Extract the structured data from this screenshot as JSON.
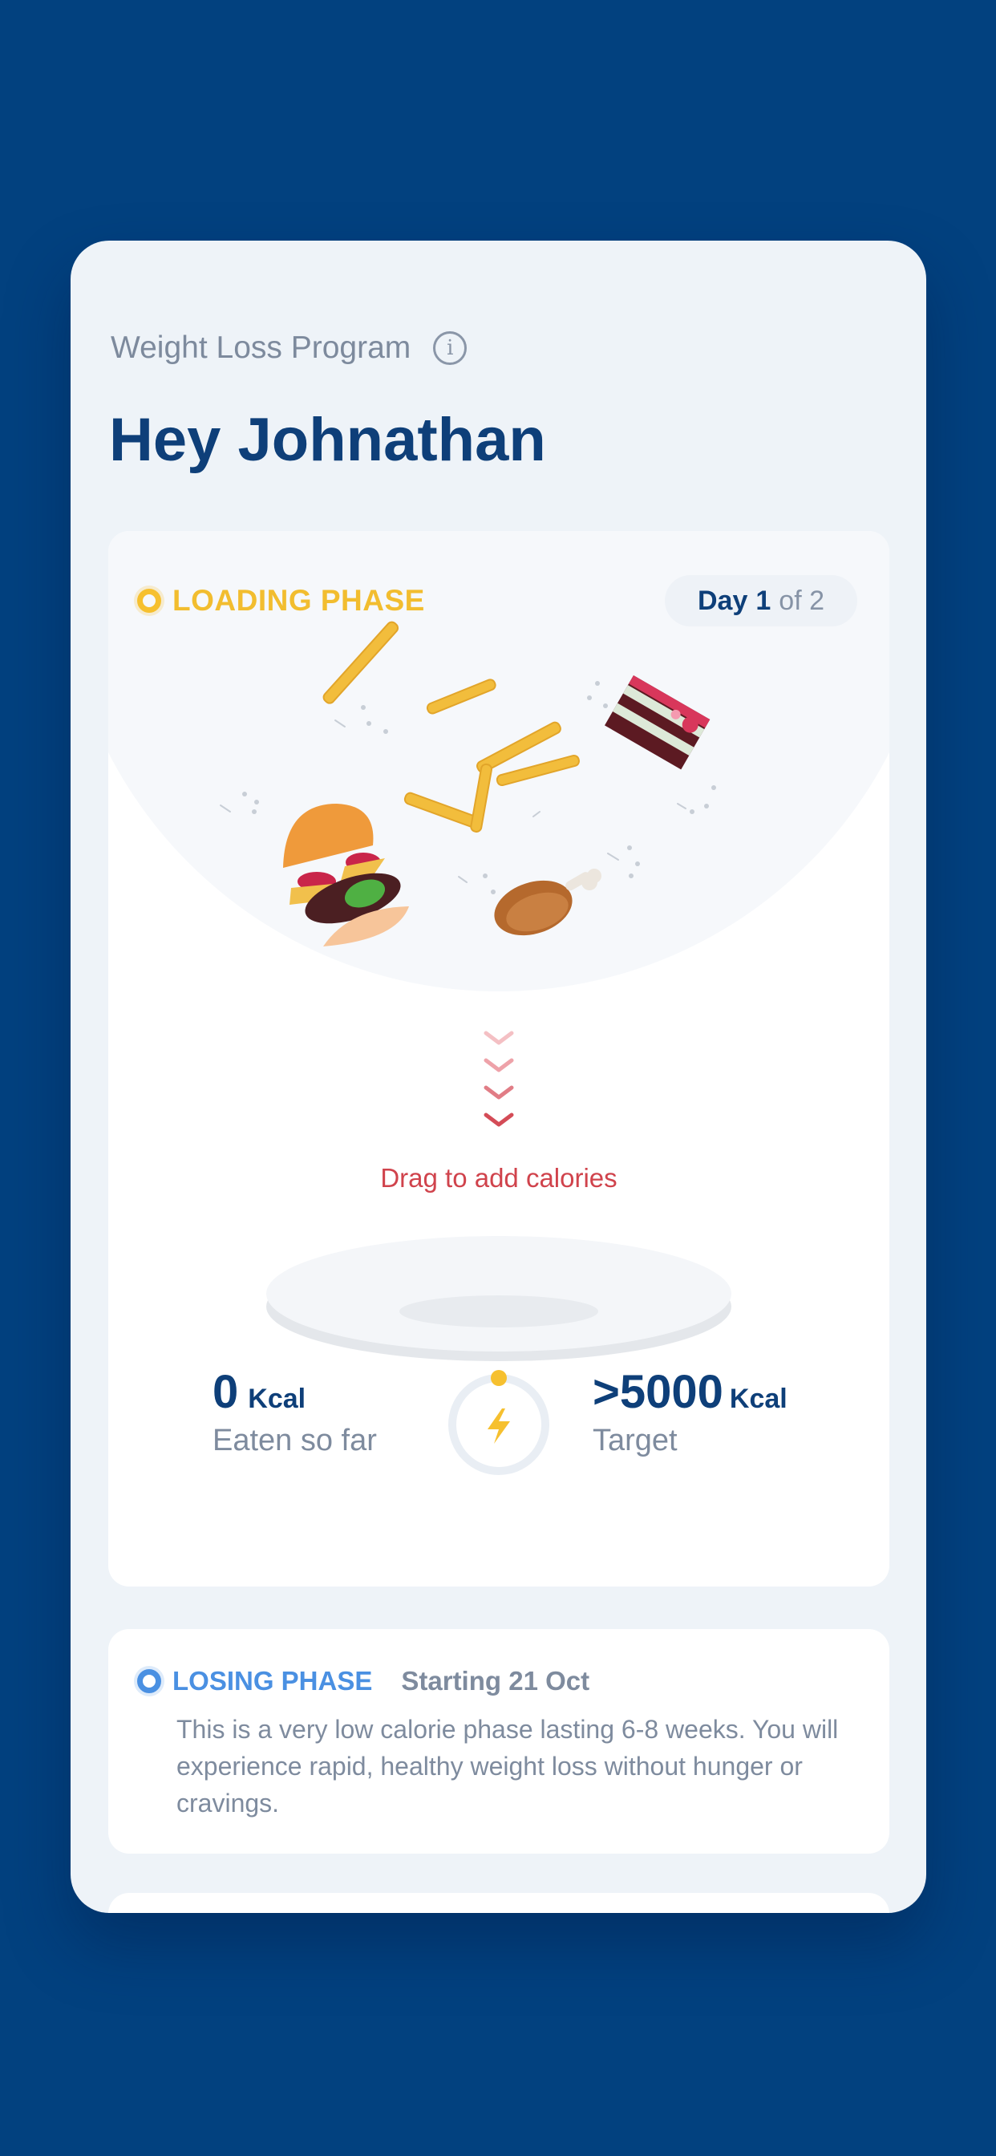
{
  "header": {
    "program_label": "Weight Loss Program",
    "info_icon": "info-icon",
    "greeting": "Hey Johnathan"
  },
  "loading_phase": {
    "title": "LOADING PHASE",
    "day_label": "Day",
    "day_current": "1",
    "day_total_text": "of 2",
    "drag_hint": "Drag to add calories",
    "eaten_value": "0",
    "eaten_unit": "Kcal",
    "eaten_caption": "Eaten so far",
    "target_value": ">5000",
    "target_unit": "Kcal",
    "target_caption": "Target",
    "gauge_icon": "lightning-icon",
    "progress_fraction": 0,
    "colors": {
      "accent": "#f2bd2f",
      "title": "#0e3f79",
      "drag": "#d0434c"
    }
  },
  "losing_phase": {
    "title": "LOSING PHASE",
    "start": "Starting 21 Oct",
    "description": "This is a very low calorie phase lasting 6-8 weeks. You will experience rapid, healthy weight loss without hunger or cravings.",
    "colors": {
      "accent": "#4a90e2"
    }
  },
  "colors": {
    "background": "#02417f",
    "card": "#eef3f8"
  }
}
